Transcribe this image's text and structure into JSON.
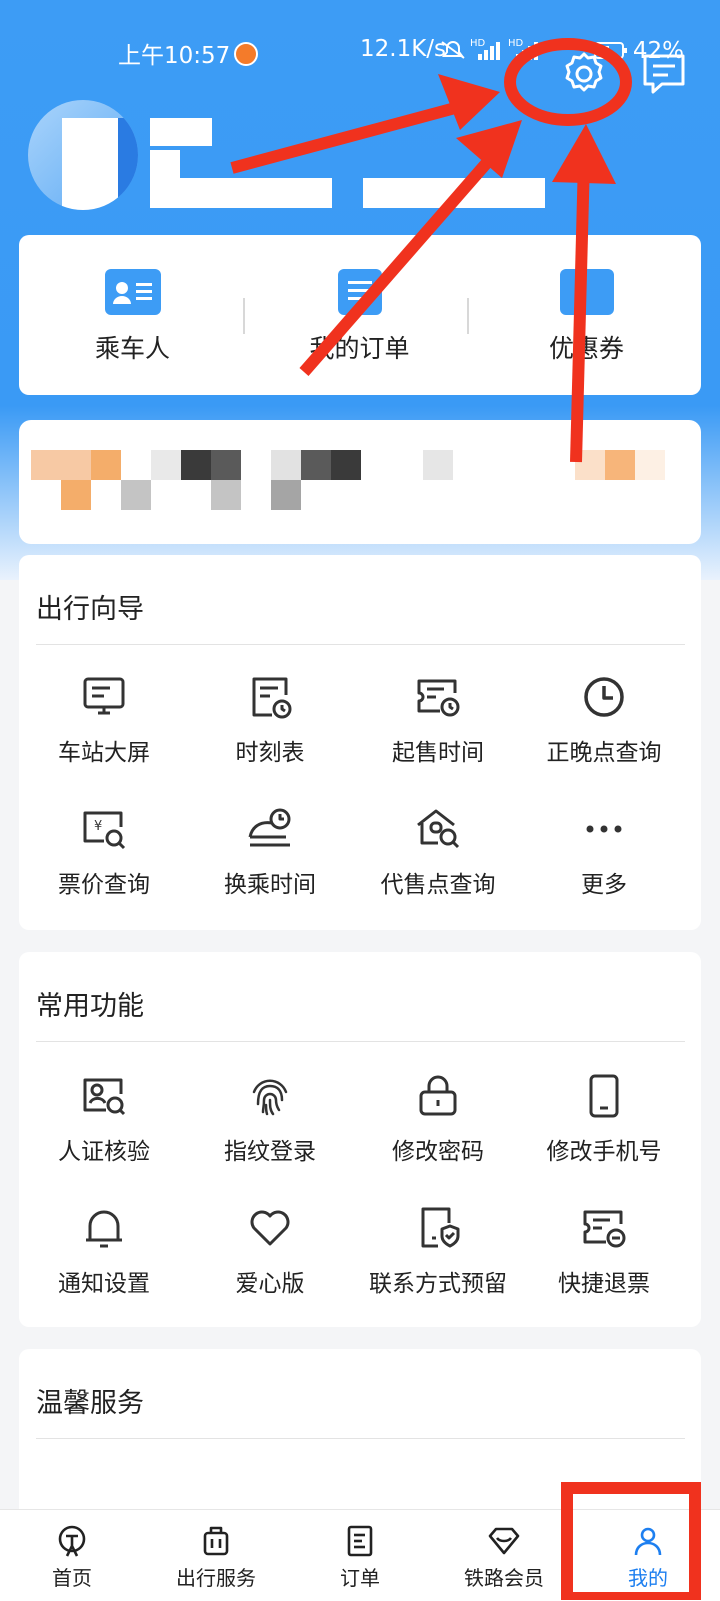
{
  "status_bar": {
    "time": "上午10:57",
    "network_speed": "12.1K/s",
    "signal_labels": [
      "HD",
      "HD"
    ],
    "battery": "42%"
  },
  "header": {
    "settings_icon": "gear-icon",
    "message_icon": "message-icon"
  },
  "quick_actions": [
    {
      "label": "乘车人",
      "icon": "id-card-icon"
    },
    {
      "label": "我的订单",
      "icon": "order-list-icon"
    },
    {
      "label": "优惠券",
      "icon": "coupon-icon"
    }
  ],
  "sections": [
    {
      "title": "出行向导",
      "items": [
        {
          "label": "车站大屏",
          "icon": "station-screen-icon"
        },
        {
          "label": "时刻表",
          "icon": "timetable-icon"
        },
        {
          "label": "起售时间",
          "icon": "sale-time-icon"
        },
        {
          "label": "正晚点查询",
          "icon": "clock-icon"
        },
        {
          "label": "票价查询",
          "icon": "fare-search-icon"
        },
        {
          "label": "换乘时间",
          "icon": "transfer-time-icon"
        },
        {
          "label": "代售点查询",
          "icon": "agency-search-icon"
        },
        {
          "label": "更多",
          "icon": "more-icon"
        }
      ]
    },
    {
      "title": "常用功能",
      "items": [
        {
          "label": "人证核验",
          "icon": "identity-verify-icon"
        },
        {
          "label": "指纹登录",
          "icon": "fingerprint-icon"
        },
        {
          "label": "修改密码",
          "icon": "lock-icon"
        },
        {
          "label": "修改手机号",
          "icon": "phone-icon"
        },
        {
          "label": "通知设置",
          "icon": "bell-icon"
        },
        {
          "label": "爱心版",
          "icon": "heart-icon"
        },
        {
          "label": "联系方式预留",
          "icon": "contact-shield-icon"
        },
        {
          "label": "快捷退票",
          "icon": "refund-ticket-icon"
        }
      ]
    },
    {
      "title": "温馨服务",
      "items": []
    }
  ],
  "bottom_nav": [
    {
      "label": "首页",
      "icon": "railway-logo-icon",
      "active": false
    },
    {
      "label": "出行服务",
      "icon": "luggage-icon",
      "active": false
    },
    {
      "label": "订单",
      "icon": "order-icon",
      "active": false
    },
    {
      "label": "铁路会员",
      "icon": "diamond-icon",
      "active": false
    },
    {
      "label": "我的",
      "icon": "user-icon",
      "active": true
    }
  ],
  "colors": {
    "header_blue": "#3a9af5",
    "active_blue": "#1d7ff0",
    "annotation_red": "#f0321e"
  }
}
